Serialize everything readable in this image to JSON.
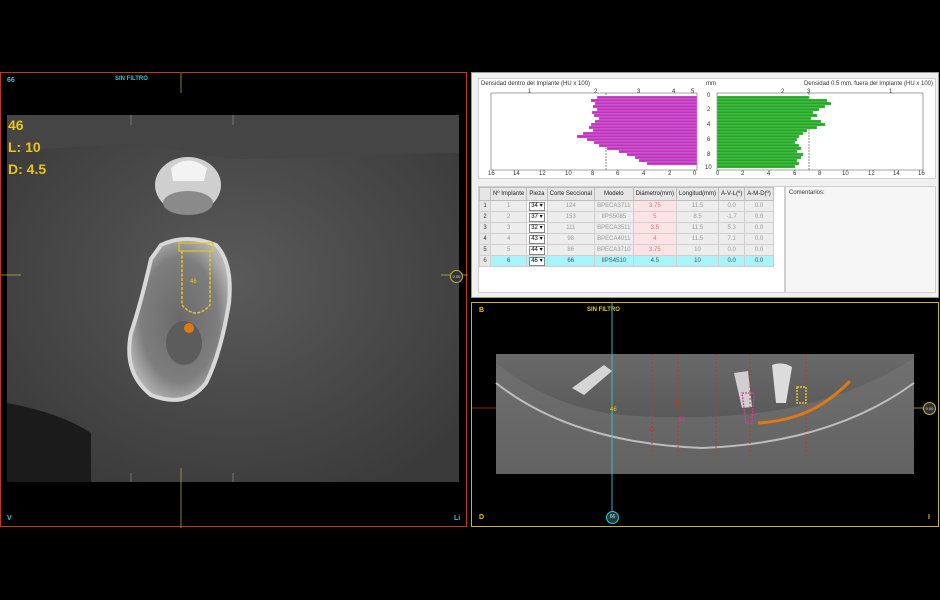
{
  "ct_view": {
    "corner_tl": "66",
    "filter_label": "SIN FILTRO",
    "tooth": "46",
    "length": "L: 10",
    "diameter": "D: 4.5",
    "implant_tag": "46",
    "corner_bl": "V",
    "corner_br": "Li",
    "nav_marker": "0.00"
  },
  "density": {
    "left_title": "Densidad dentro del Implante (HU x 100)",
    "right_title": "Densidad 0.5 mm. fuera del Implante (HU x 100)",
    "unit": "mm",
    "left_top_ticks": [
      "1",
      "2",
      "3",
      "4",
      "5"
    ],
    "left_bottom_ticks": [
      "16",
      "14",
      "12",
      "10",
      "8",
      "6",
      "4",
      "2",
      "0"
    ],
    "right_top_ticks": [
      "2",
      "3",
      "1"
    ],
    "right_bottom_ticks": [
      "0",
      "2",
      "4",
      "6",
      "8",
      "10",
      "12",
      "14",
      "16"
    ],
    "depth_ticks": [
      "0",
      "2",
      "4",
      "6",
      "8",
      "10"
    ],
    "comments_label": "Comentarios:"
  },
  "implants_table": {
    "headers": [
      "Nº Implante",
      "Pieza",
      "Corte Seccional",
      "Modelo",
      "Diámetro(mm)",
      "Longitud(mm)",
      "A-V-L(º)",
      "A-M-D(º)"
    ],
    "rows": [
      {
        "idx": "1",
        "n": "1",
        "pieza": "34",
        "corte": "124",
        "modelo": "BPECA3711",
        "diam": "3.75",
        "long": "11.5",
        "avl": "0.0",
        "amd": "0.0"
      },
      {
        "idx": "2",
        "n": "2",
        "pieza": "37",
        "corte": "153",
        "modelo": "IIPS5085",
        "diam": "5",
        "long": "8.5",
        "avl": "-1.7",
        "amd": "0.0"
      },
      {
        "idx": "3",
        "n": "3",
        "pieza": "32",
        "corte": "111",
        "modelo": "BPECA3511",
        "diam": "3.5",
        "long": "11.5",
        "avl": "5.3",
        "amd": "0.0"
      },
      {
        "idx": "4",
        "n": "4",
        "pieza": "43",
        "corte": "98",
        "modelo": "BPECA4011",
        "diam": "4",
        "long": "11.5",
        "avl": "7.1",
        "amd": "0.0"
      },
      {
        "idx": "5",
        "n": "5",
        "pieza": "44",
        "corte": "86",
        "modelo": "BPECA3710",
        "diam": "3.75",
        "long": "10",
        "avl": "0.0",
        "amd": "0.0"
      },
      {
        "idx": "6",
        "n": "6",
        "pieza": "46",
        "corte": "66",
        "modelo": "IIPS4510",
        "diam": "4.5",
        "long": "10",
        "avl": "0.0",
        "amd": "0.0"
      }
    ]
  },
  "pan_view": {
    "corner_tl": "B",
    "filter_label": "SIN FILTRO",
    "tag_a": "46",
    "tag_b": "43",
    "corner_bl": "D",
    "corner_br": "I",
    "nav_marker_right": "0.00",
    "nav_marker_bottom": "66"
  },
  "colors": {
    "ct_border": "#c0391b",
    "pan_border": "#c9b13a",
    "implant_yellow": "#e9c41c",
    "nerve_orange": "#e07a10",
    "density_in": "#c033c0",
    "density_out": "#22a822",
    "selected_row": "#a9f3fb"
  }
}
